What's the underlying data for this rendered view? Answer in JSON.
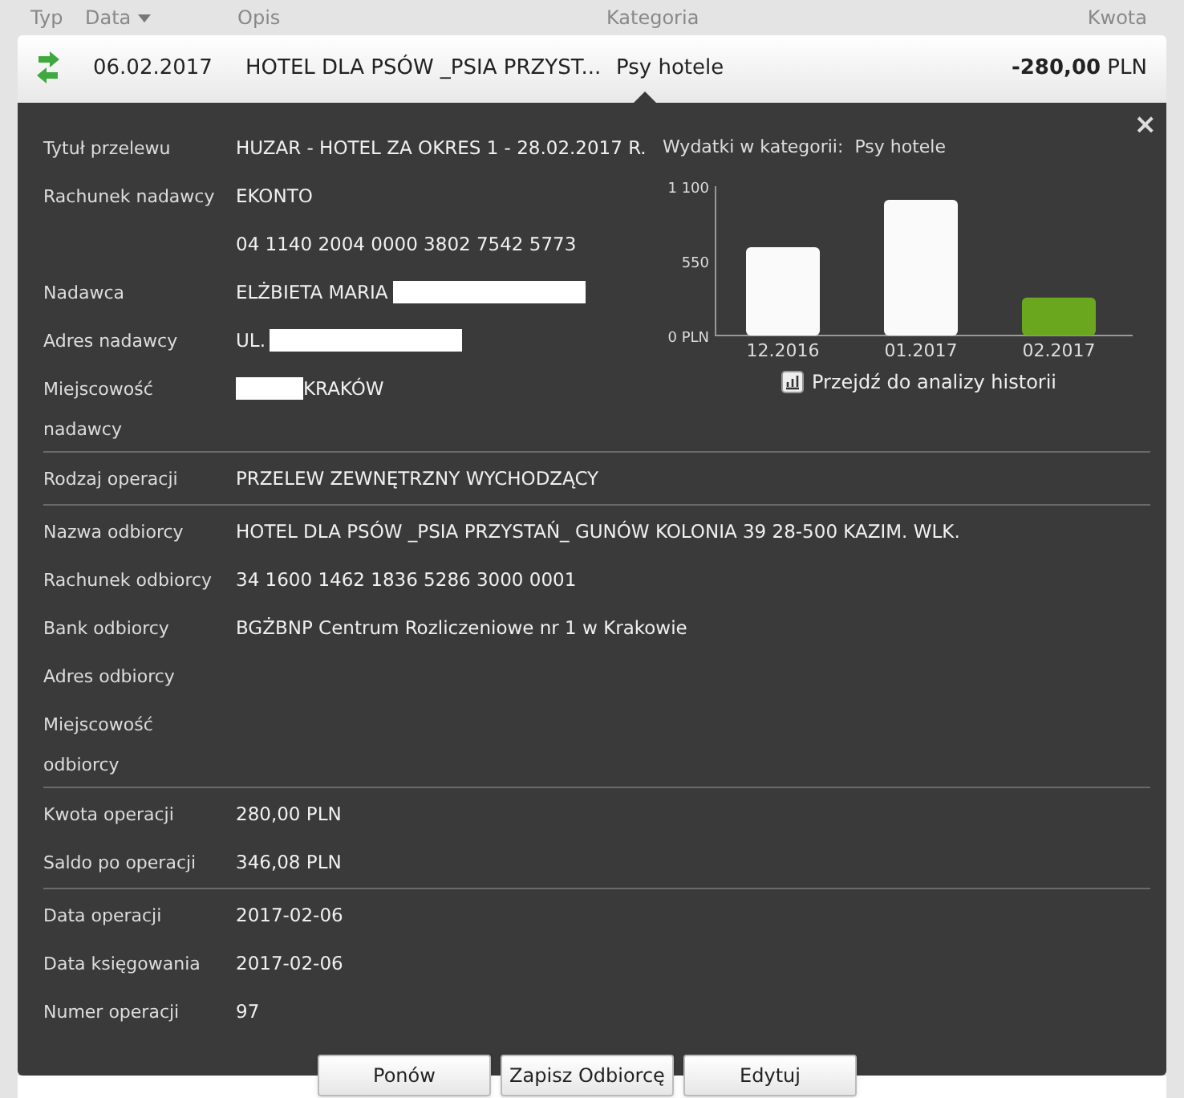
{
  "table": {
    "columns": [
      {
        "label": "Typ"
      },
      {
        "label": "Data",
        "sorted": true
      },
      {
        "label": "Opis"
      },
      {
        "label": "Kategoria"
      },
      {
        "label": "Kwota"
      }
    ],
    "row": {
      "date": "06.02.2017",
      "description": "HOTEL DLA PSÓW _PSIA PRZYST...",
      "category": "Psy hotele",
      "amount": "-280,00",
      "currency": "PLN"
    }
  },
  "details": {
    "close": "×",
    "sections": [
      [
        {
          "label": "Tytuł przelewu",
          "value": "HUZAR - HOTEL ZA OKRES 1 - 28.02.2017 R."
        },
        {
          "label": "Rachunek nadawcy",
          "value": "EKONTO"
        },
        {
          "value": "04 1140 2004 0000 3802 7542 5773"
        },
        {
          "label": "Nadawca",
          "value": "ELŻBIETA MARIA",
          "redacted_after": true
        },
        {
          "label": "Adres nadawcy",
          "value": "UL.",
          "redacted_after": true
        },
        {
          "label": "Miejscowość nadawcy",
          "value": "KRAKÓW",
          "redacted_before": true
        }
      ],
      [
        {
          "label": "Rodzaj operacji",
          "value": "PRZELEW ZEWNĘTRZNY WYCHODZĄCY"
        }
      ],
      [
        {
          "label": "Nazwa odbiorcy",
          "value": "HOTEL DLA PSÓW _PSIA PRZYSTAŃ_ GUNÓW KOLONIA 39 28-500 KAZIM. WLK."
        },
        {
          "label": "Rachunek odbiorcy",
          "value": "34 1600 1462 1836 5286 3000 0001"
        },
        {
          "label": "Bank odbiorcy",
          "value": "BGŻBNP Centrum Rozliczeniowe nr 1 w Krakowie"
        },
        {
          "label": "Adres odbiorcy"
        },
        {
          "label": "Miejscowość odbiorcy"
        }
      ],
      [
        {
          "label": "Kwota operacji",
          "value": "280,00 PLN"
        },
        {
          "label": "Saldo po operacji",
          "value": "346,08 PLN"
        }
      ],
      [
        {
          "label": "Data operacji",
          "value": "2017-02-06"
        },
        {
          "label": "Data księgowania",
          "value": "2017-02-06"
        },
        {
          "label": "Numer operacji",
          "value": "97"
        }
      ]
    ],
    "chart_label": "Wydatki w kategorii:",
    "chart_category": "Psy hotele",
    "chart_data": {
      "type": "bar",
      "categories": [
        "12.2016",
        "01.2017",
        "02.2017"
      ],
      "values": [
        650,
        1000,
        280
      ],
      "colors": [
        "#fafafa",
        "#fafafa",
        "#6aa61e"
      ],
      "ylim": [
        0,
        1100
      ],
      "yticks": [
        {
          "value": 0,
          "label": "0 PLN"
        },
        {
          "value": 550,
          "label": "550"
        },
        {
          "value": 1100,
          "label": "1 100"
        }
      ]
    },
    "history_link": "Przejdź do analizy historii",
    "buttons": [
      "Ponów",
      "Zapisz Odbiorcę",
      "Edytuj"
    ]
  }
}
